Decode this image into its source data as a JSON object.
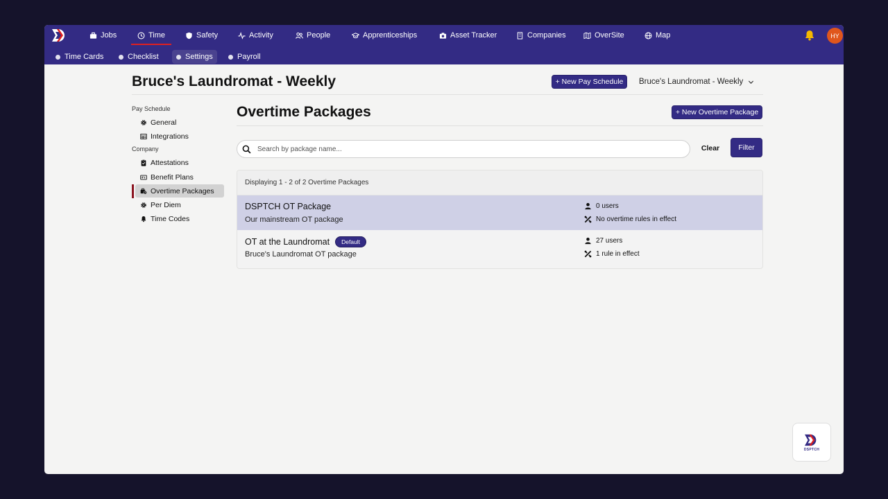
{
  "brand": {
    "primary": "#332b84",
    "accent": "#e0201f",
    "logo_text": "DSPTCH"
  },
  "topnav": {
    "items": [
      {
        "label": "Jobs",
        "icon": "briefcase-icon"
      },
      {
        "label": "Time",
        "icon": "clock-icon",
        "active": true
      },
      {
        "label": "Safety",
        "icon": "shield-icon"
      },
      {
        "label": "Activity",
        "icon": "pulse-icon"
      },
      {
        "label": "People",
        "icon": "people-icon"
      },
      {
        "label": "Apprenticeships",
        "icon": "graduation-cap-icon"
      },
      {
        "label": "Asset Tracker",
        "icon": "camera-icon"
      },
      {
        "label": "Companies",
        "icon": "building-icon"
      },
      {
        "label": "OverSite",
        "icon": "map-fold-icon"
      },
      {
        "label": "Map",
        "icon": "globe-icon"
      }
    ],
    "avatar_initials": "HY"
  },
  "subnav": {
    "items": [
      {
        "label": "Time Cards"
      },
      {
        "label": "Checklist"
      },
      {
        "label": "Settings",
        "active": true
      },
      {
        "label": "Payroll"
      }
    ]
  },
  "header": {
    "title": "Bruce's Laundromat - Weekly",
    "new_pay_schedule": "+ New Pay Schedule",
    "schedule_selected": "Bruce's Laundromat - Weekly"
  },
  "sidebar": {
    "section_pay_schedule": "Pay Schedule",
    "pay_items": [
      {
        "label": "General",
        "icon": "gear-icon"
      },
      {
        "label": "Integrations",
        "icon": "table-icon"
      }
    ],
    "section_company": "Company",
    "company_items": [
      {
        "label": "Attestations",
        "icon": "clipboard-check-icon"
      },
      {
        "label": "Benefit Plans",
        "icon": "money-check-icon"
      },
      {
        "label": "Overtime Packages",
        "icon": "briefcase-clock-icon",
        "active": true
      },
      {
        "label": "Per Diem",
        "icon": "gear-icon"
      },
      {
        "label": "Time Codes",
        "icon": "bell-icon"
      }
    ]
  },
  "main": {
    "title": "Overtime Packages",
    "new_button": "+ New Overtime Package",
    "search_placeholder": "Search by package name...",
    "clear_label": "Clear",
    "filter_label": "Filter",
    "list_summary": "Displaying 1 - 2 of 2 Overtime Packages",
    "packages": [
      {
        "name": "DSPTCH OT Package",
        "description": "Our mainstream OT package",
        "users": "0 users",
        "rules": "No overtime rules in effect",
        "selected": true
      },
      {
        "name": "OT at the Laundromat",
        "badge": "Default",
        "description": "Bruce's Laundromat OT package",
        "users": "27 users",
        "rules": "1 rule in effect"
      }
    ]
  }
}
